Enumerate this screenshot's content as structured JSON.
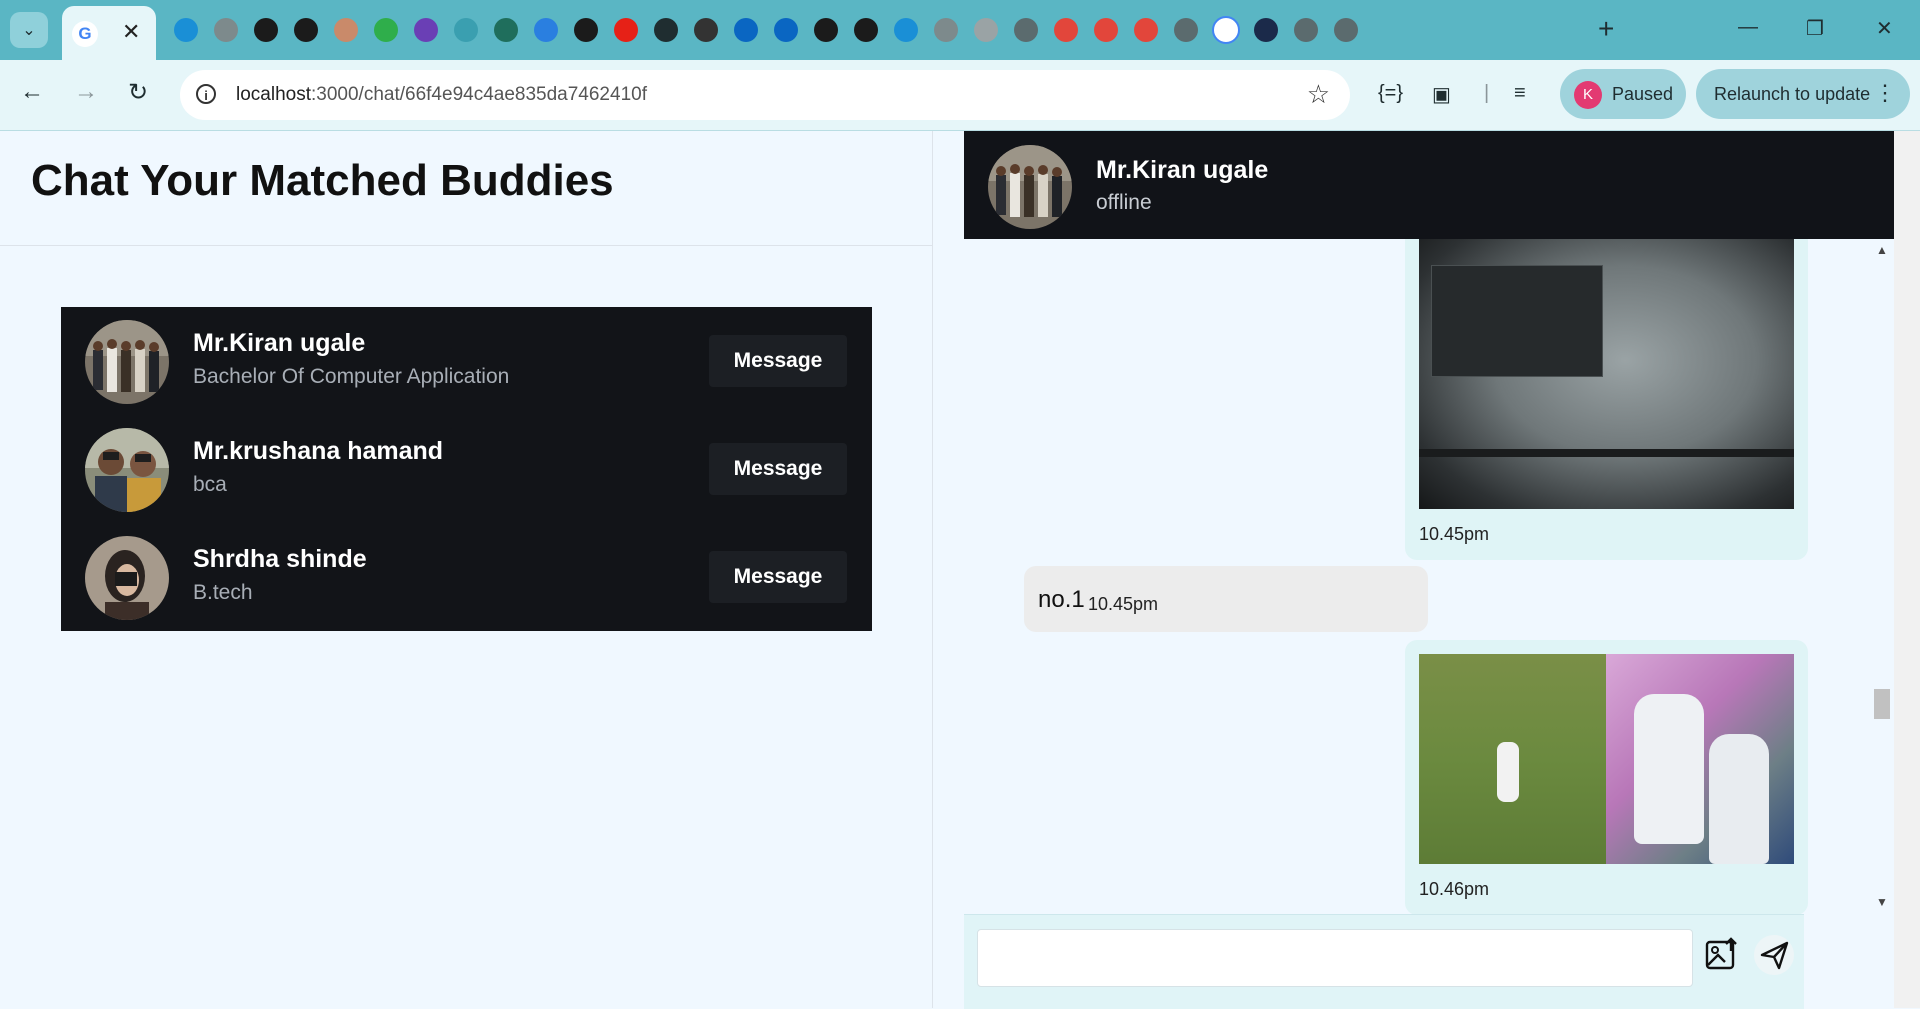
{
  "browser": {
    "url_host": "localhost",
    "url_path": ":3000/chat/66f4e94c4ae835da7462410f",
    "profile_initial": "K",
    "profile_status": "Paused",
    "relaunch_label": "Relaunch to update",
    "tab_icons": [
      "tab-icon-site",
      "tab-icon-globe",
      "tab-icon-dark",
      "tab-icon-power",
      "tab-icon-figure",
      "tab-icon-whatsapp-53",
      "tab-icon-n",
      "tab-icon-play",
      "tab-icon-meet",
      "tab-icon-bot",
      "tab-icon-v",
      "tab-icon-youtube",
      "tab-icon-cloud",
      "tab-icon-cloud2",
      "tab-icon-linkedin",
      "tab-icon-linkedin2",
      "tab-icon-openai",
      "tab-icon-github",
      "tab-icon-site2",
      "tab-icon-globe2",
      "tab-icon-globe3",
      "tab-icon-chrome",
      "tab-icon-warning",
      "tab-icon-warning2",
      "tab-icon-warning3",
      "tab-icon-chrome2",
      "tab-icon-google",
      "tab-icon-d",
      "tab-icon-chrome3",
      "tab-icon-chrome4"
    ]
  },
  "page": {
    "title": "Chat Your Matched Buddies"
  },
  "buddies": [
    {
      "name": "Mr.Kiran ugale",
      "course": "Bachelor Of Computer Application",
      "button": "Message"
    },
    {
      "name": "Mr.krushana hamand",
      "course": "bca",
      "button": "Message"
    },
    {
      "name": "Shrdha shinde",
      "course": "B.tech",
      "button": "Message"
    }
  ],
  "chat": {
    "name": "Mr.Kiran ugale",
    "status": "offline",
    "messages": [
      {
        "type": "image",
        "direction": "out",
        "time": "10.45pm"
      },
      {
        "type": "text",
        "direction": "in",
        "text": "no.1",
        "time": "10.45pm"
      },
      {
        "type": "image",
        "direction": "out",
        "time": "10.46pm"
      }
    ],
    "input_value": ""
  },
  "colors": {
    "tabstrip": "#5ab6c4",
    "toolbar": "#e6f6f9",
    "page_bg": "#f0f8ff",
    "buddy_card": "#121418",
    "chat_header": "#111318",
    "outgoing_bubble": "#dff4f6",
    "incoming_bubble": "#ececec"
  }
}
